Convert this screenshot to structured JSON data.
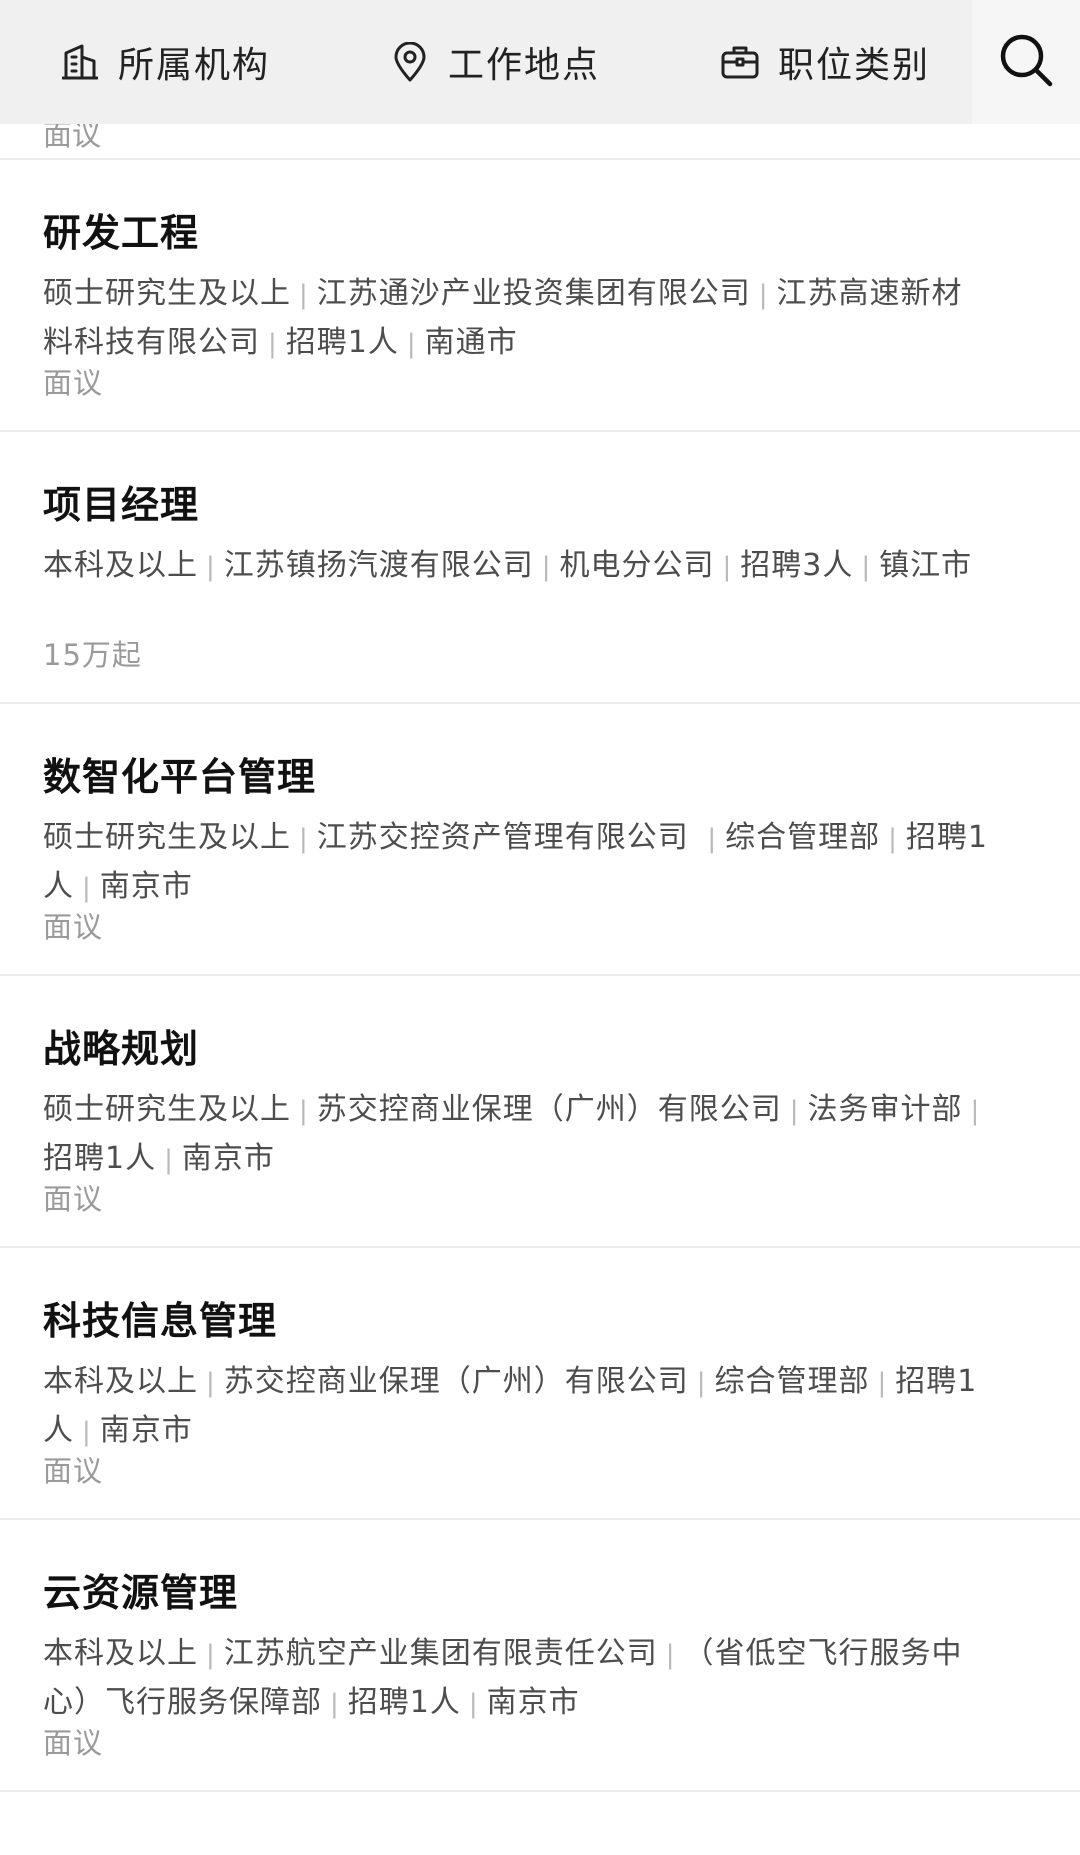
{
  "filters": {
    "org_label": "所属机构",
    "location_label": "工作地点",
    "category_label": "职位类别"
  },
  "prev_item_salary": "面议",
  "jobs": [
    {
      "title": "研发工程",
      "meta": [
        "硕士研究生及以上",
        "江苏通沙产业投资集团有限公司",
        "江苏高速新材料科技有限公司",
        "招聘1人",
        "南通市"
      ],
      "salary": "面议"
    },
    {
      "title": "项目经理",
      "meta": [
        "本科及以上",
        "江苏镇扬汽渡有限公司",
        "机电分公司",
        "招聘3人",
        "镇江市"
      ],
      "salary": "15万起"
    },
    {
      "title": "数智化平台管理",
      "meta": [
        "硕士研究生及以上",
        "江苏交控资产管理有限公司 ",
        "综合管理部",
        "招聘1人",
        "南京市"
      ],
      "salary": "面议"
    },
    {
      "title": "战略规划",
      "meta": [
        "硕士研究生及以上",
        "苏交控商业保理（广州）有限公司",
        "法务审计部",
        "招聘1人",
        "南京市"
      ],
      "salary": "面议"
    },
    {
      "title": "科技信息管理",
      "meta": [
        "本科及以上",
        "苏交控商业保理（广州）有限公司",
        "综合管理部",
        "招聘1人",
        "南京市"
      ],
      "salary": "面议"
    },
    {
      "title": "云资源管理",
      "meta": [
        "本科及以上",
        "江苏航空产业集团有限责任公司",
        "（省低空飞行服务中心）飞行服务保障部",
        "招聘1人",
        "南京市"
      ],
      "salary": "面议"
    }
  ]
}
